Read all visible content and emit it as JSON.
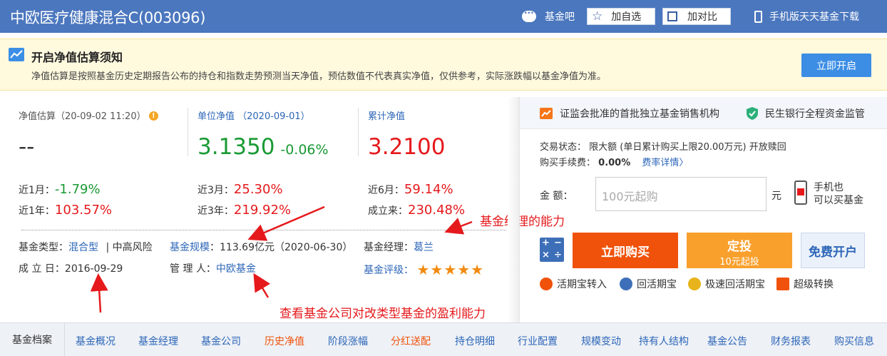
{
  "header": {
    "title": "中欧医疗健康混合C(003096)",
    "forum": "基金吧",
    "add_watch": "加自选",
    "add_compare": "加对比",
    "app_download": "手机版天天基金下载"
  },
  "notice": {
    "title": "开启净值估算须知",
    "text": "净值估算是按照基金历史定期报告公布的持仓和指数走势预测当天净值，预估数值不代表真实净值，仅供参考，实际涨跌幅以基金净值为准。",
    "button": "立即开启"
  },
  "nav": {
    "estimate_label": "净值估算（20-09-02 11:20）",
    "estimate_value": "--",
    "unit_label": "单位净值 （2020-09-01）",
    "unit_value": "3.1350",
    "unit_change": "-0.06%",
    "cum_label": "累计净值",
    "cum_value": "3.2100"
  },
  "performance": {
    "m1_label": "近1月：",
    "m1_value": "-1.79%",
    "m3_label": "近3月：",
    "m3_value": "25.30%",
    "m6_label": "近6月：",
    "m6_value": "59.14%",
    "y1_label": "近1年：",
    "y1_value": "103.57%",
    "y3_label": "近3年：",
    "y3_value": "219.92%",
    "since_label": "成立来：",
    "since_value": "230.48%"
  },
  "info": {
    "type_label": "基金类型：",
    "type_value": "混合型",
    "risk": "|  中高风险",
    "scale_label": "基金规模",
    "scale_value": "：113.69亿元（2020-06-30）",
    "manager_label": "基金经理：",
    "manager_value": "葛兰",
    "date_label": "成 立 日：",
    "date_value": "2016-09-29",
    "company_label": "管 理 人：",
    "company_value": "中欧基金",
    "rating_label": "基金评级：",
    "rating_stars": "★★★★★",
    "rating_value": 5
  },
  "annotations": {
    "manager_ability": "基金经理的能力",
    "company_ability": "查看基金公司对改类型基金的盈利能力"
  },
  "right": {
    "trust1": "证监会批准的首批独立基金销售机构",
    "trust2": "民生银行全程资金监管",
    "status": "交易状态：  限大额 (单日累计购买上限20.00万元)    开放赎回",
    "fee_label": "购买手续费：",
    "fee_value": "0.00%",
    "fee_link": "费率详情〉",
    "amount_label": "金      额：",
    "amount_placeholder": "100元起购",
    "unit": "元",
    "mobile_line1": "手机也",
    "mobile_line2": "可以买基金",
    "buy": "立即购买",
    "fixed": "定投",
    "fixed_sub": "10元起投",
    "free": "免费开户",
    "quick1": "活期宝转入",
    "quick2": "回活期宝",
    "quick3": "极速回活期宝",
    "quick4": "超级转换"
  },
  "tabs": {
    "head": "基金档案",
    "items": [
      "基金概况",
      "基金经理",
      "基金公司",
      "历史净值",
      "阶段涨幅",
      "分红送配",
      "持仓明细",
      "行业配置",
      "规模变动",
      "持有人结构",
      "基金公告",
      "财务报表",
      "购买信息"
    ]
  },
  "colors": {
    "header": "#4b77be",
    "red": "#e5191c",
    "green": "#1a9a34",
    "orange": "#f0520b"
  }
}
